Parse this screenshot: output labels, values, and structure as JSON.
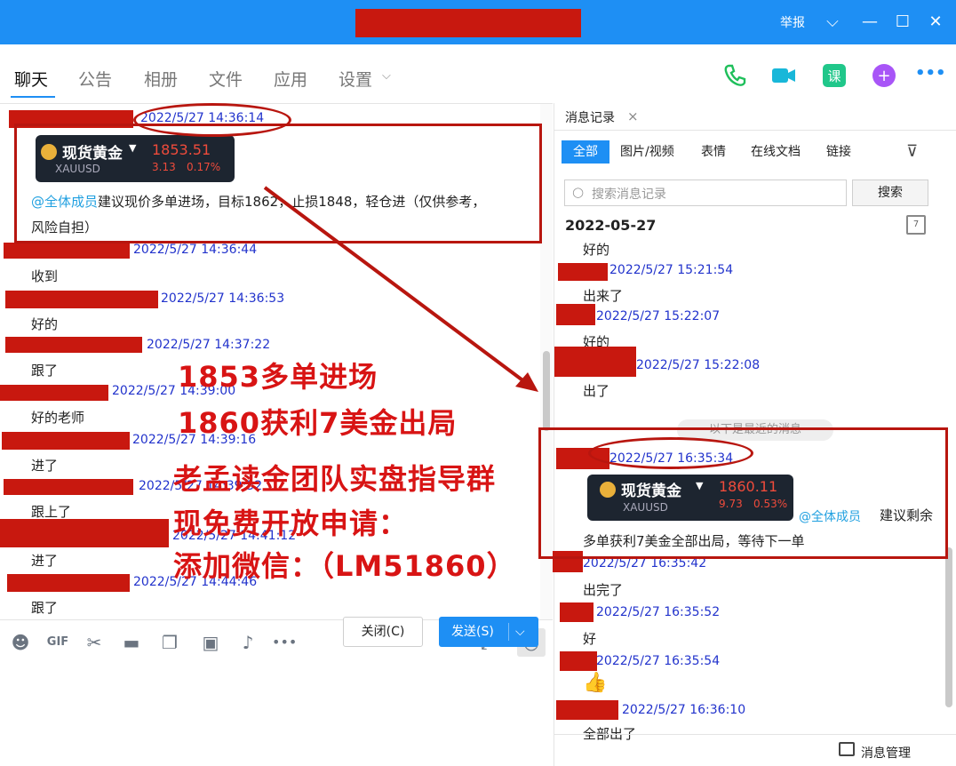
{
  "titlebar": {
    "report_label": "举报",
    "dropdown_glyph": "⌵",
    "minimize_glyph": "—",
    "maximize_glyph": "☐",
    "close_glyph": "✕"
  },
  "tabs": [
    {
      "label": "聊天"
    },
    {
      "label": "公告"
    },
    {
      "label": "相册"
    },
    {
      "label": "文件"
    },
    {
      "label": "应用"
    },
    {
      "label": "设置"
    }
  ],
  "header_icons": [
    "phone-icon",
    "video-call-icon",
    "course-icon",
    "add-app-icon",
    "more-icon"
  ],
  "header_icon_glyphs": {
    "course": "课",
    "add": "+",
    "more": "•••"
  },
  "chat": {
    "top_ts": "2022/5/27 14:36:14",
    "card1": {
      "name": "现货黄金",
      "symbol": "XAUUSD",
      "price": "1853.51",
      "change": "3.13",
      "pct": "0.17%"
    },
    "first_mention": "@全体成员",
    "first_text_1": "建议现价多单进场，目标1862，止损1848，轻仓进（仅供参考，",
    "first_text_2": "风险自担）",
    "messages": [
      {
        "ts": "2022/5/27 14:36:44",
        "text": "收到"
      },
      {
        "ts": "2022/5/27 14:36:53",
        "text": "好的"
      },
      {
        "ts": "2022/5/27 14:37:22",
        "text": "跟了"
      },
      {
        "ts": "2022/5/27 14:39:00",
        "text": "好的老师"
      },
      {
        "ts": "2022/5/27 14:39:16",
        "text": "进了"
      },
      {
        "ts": "2022/5/27 14:39:32",
        "text": "跟上了"
      },
      {
        "ts": "2022/5/27 14:41:12",
        "text": "进了"
      },
      {
        "ts": "2022/5/27 14:44:46",
        "text": "跟了"
      }
    ]
  },
  "overlay": {
    "line1": "1853多单进场",
    "line2": "1860获利7美金出局",
    "line3": "老孟读金团队实盘指导群",
    "line4": "现免费开放申请：",
    "line5": "添加微信：（LM51860）"
  },
  "toolbar": {
    "emoji": "☻",
    "gif": "GIF",
    "scissors": "✂",
    "folder": "▬",
    "doc": "❐",
    "image": "▣",
    "bell": "♪",
    "more": "•••",
    "expand": "⤢",
    "history": "◷"
  },
  "composer": {
    "close_label": "关闭(C)",
    "send_label": "发送(S)",
    "send_caret": "⌵"
  },
  "history": {
    "tab_label": "消息记录",
    "tab_close": "×",
    "filters": [
      "全部",
      "图片/视频",
      "表情",
      "在线文档",
      "链接"
    ],
    "filter_icon": "⊽",
    "search_placeholder": "搜索消息记录",
    "search_icon": "○",
    "search_button": "搜索",
    "date": "2022-05-27",
    "calendar": "7",
    "first_text": "好的",
    "items": [
      {
        "ts": "2022/5/27 15:21:54",
        "text": "出来了"
      },
      {
        "ts": "2022/5/27 15:22:07",
        "text": "好的"
      },
      {
        "ts": "2022/5/27 15:22:08",
        "text": "出了"
      }
    ],
    "system_notice": "以下是最近的消息",
    "key_ts": "2022/5/27 16:35:34",
    "card2": {
      "name": "现货黄金",
      "symbol": "XAUUSD",
      "price": "1860.11",
      "change": "9.73",
      "pct": "0.53%"
    },
    "key_mention": "@全体成员",
    "key_text_1": "建议剩余",
    "key_text_2": "多单获利7美金全部出局，等待下一单",
    "after": [
      {
        "ts": "2022/5/27 16:35:42",
        "text": "出完了"
      },
      {
        "ts": "2022/5/27 16:35:52",
        "text": "好"
      },
      {
        "ts": "2022/5/27 16:35:54",
        "text": "👍"
      },
      {
        "ts": "2022/5/27 16:36:10",
        "text": "全部出了"
      }
    ],
    "manage_label": "消息管理"
  },
  "colors": {
    "brand_blue": "#1e8ff4",
    "redact_red": "#c8180f",
    "annotation_red": "#b8160f",
    "overlay_red": "#d81414",
    "timestamp_blue": "#2233cc"
  }
}
